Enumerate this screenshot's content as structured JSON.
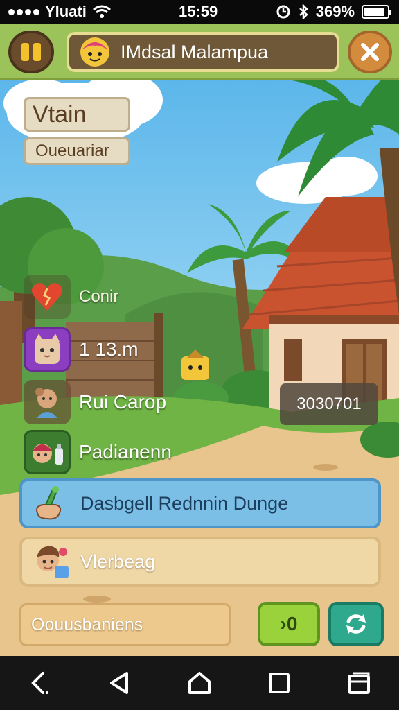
{
  "status_bar": {
    "carrier": "Yluati",
    "time": "15:59",
    "battery_text": "369%",
    "battery_level": 0.9
  },
  "hud": {
    "player_name": "IMdsal Malampua",
    "pause_icon": "pause-icon",
    "close_icon": "close-icon"
  },
  "title_tag": "Vtain",
  "subtitle_tag": "Oueuariar",
  "stats": [
    {
      "icon": "broken-heart-icon",
      "label": "Conir"
    },
    {
      "icon": "cat-portrait-icon",
      "label": "1  13.m"
    },
    {
      "icon": "character-portrait-icon",
      "label": "Rui Carop"
    },
    {
      "icon": "chef-portrait-icon",
      "label": "Padianenn"
    }
  ],
  "value_box": "3030701",
  "menu": [
    {
      "icon": "tool-hand-icon",
      "label": "Dasbgell Rednnin Dunge"
    },
    {
      "icon": "villager-icon",
      "label": "Vlerbeag"
    }
  ],
  "bottom_field": "Oouusbaniens",
  "count_button": "›0",
  "refresh_icon": "refresh-icon",
  "nav": [
    "back-icon",
    "triangle-back-icon",
    "home-icon",
    "recents-icon",
    "window-icon"
  ],
  "colors": {
    "hud_green": "#9cc25a",
    "accent_yellow": "#f3c22b",
    "dungeon_blue": "#7bbfe6",
    "count_green": "#9ad23c",
    "refresh_teal": "#2fa98e"
  }
}
